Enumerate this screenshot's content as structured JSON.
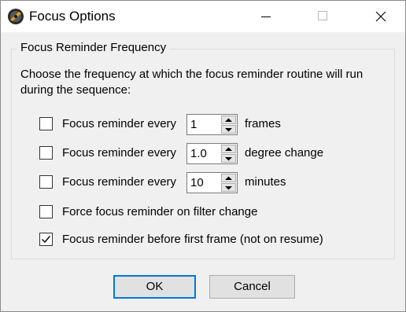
{
  "window": {
    "title": "Focus Options"
  },
  "group": {
    "legend": "Focus Reminder Frequency",
    "description_line1": "Choose the frequency at which the focus reminder routine will run",
    "description_line2": "during the sequence:"
  },
  "options": [
    {
      "label": "Focus reminder every",
      "value": "1",
      "unit": "frames",
      "checked": false
    },
    {
      "label": "Focus reminder every",
      "value": "1.0",
      "unit": "degree change",
      "checked": false
    },
    {
      "label": "Focus reminder every",
      "value": "10",
      "unit": "minutes",
      "checked": false
    },
    {
      "label": "Force focus reminder on filter change",
      "checked": false
    },
    {
      "label": "Focus reminder before first frame (not on resume)",
      "checked": true
    }
  ],
  "buttons": {
    "ok": "OK",
    "cancel": "Cancel"
  },
  "colors": {
    "accent": "#0078d7",
    "dialog_bg": "#f0f0f0"
  },
  "icons": {
    "app": "focus-lens-icon",
    "minimize": "minimize-icon",
    "maximize": "maximize-icon",
    "close": "close-icon"
  }
}
